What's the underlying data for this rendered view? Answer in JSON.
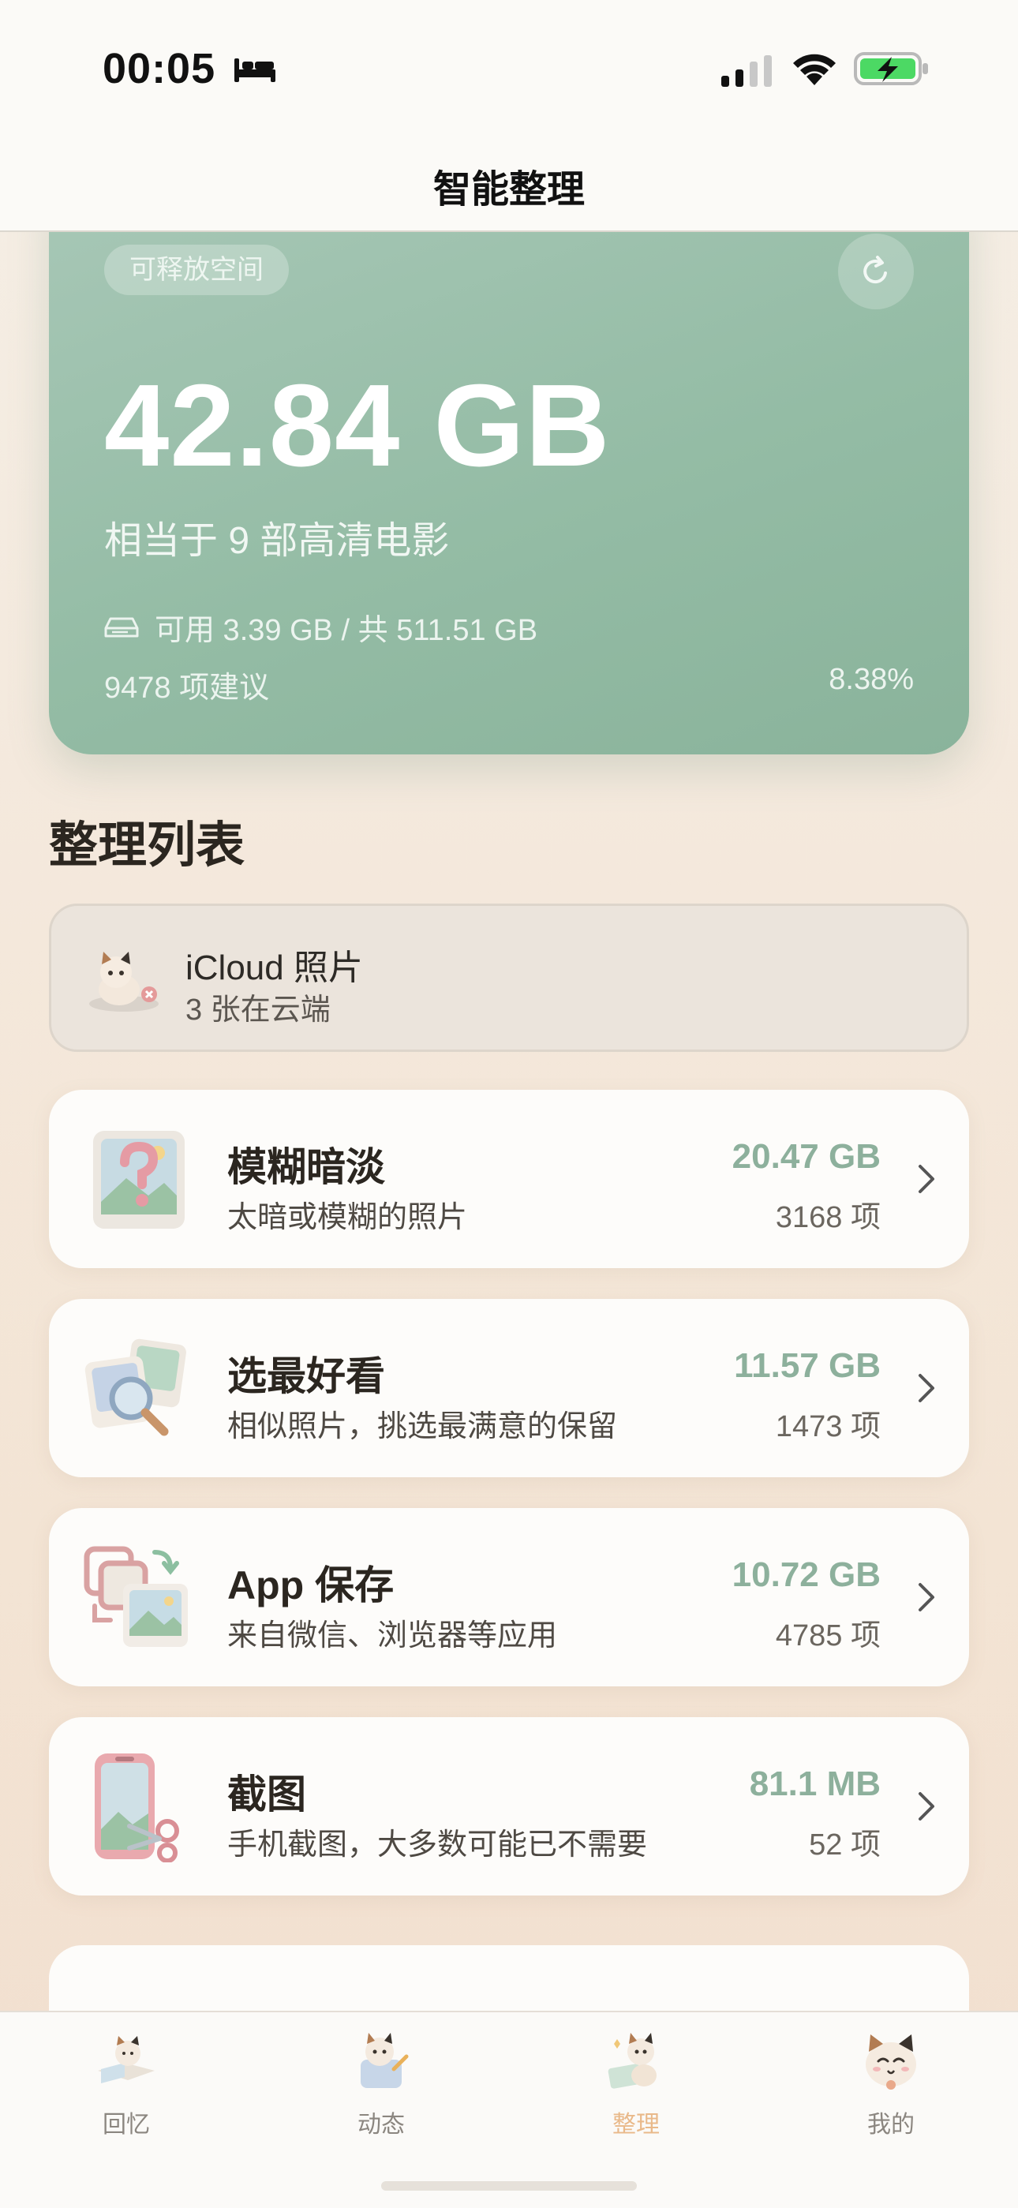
{
  "status_bar": {
    "time": "00:05"
  },
  "nav": {
    "title": "智能整理"
  },
  "hero": {
    "pill": "可释放空间",
    "size": "42.84 GB",
    "equivalent": "相当于 9 部高清电影",
    "available": "可用 3.39 GB / 共 511.51 GB",
    "suggestions": "9478 项建议",
    "percent": "8.38%"
  },
  "section": {
    "title": "整理列表"
  },
  "icloud": {
    "title": "iCloud 照片",
    "subtitle": "3 张在云端"
  },
  "cards": [
    {
      "title": "模糊暗淡",
      "subtitle": "太暗或模糊的照片",
      "size": "20.47 GB",
      "count": "3168 项",
      "icon": "blurry-photo-icon"
    },
    {
      "title": "选最好看",
      "subtitle": "相似照片，挑选最满意的保留",
      "size": "11.57 GB",
      "count": "1473 项",
      "icon": "similar-photos-icon"
    },
    {
      "title": "App 保存",
      "subtitle": "来自微信、浏览器等应用",
      "size": "10.72 GB",
      "count": "4785 项",
      "icon": "app-saved-icon"
    },
    {
      "title": "截图",
      "subtitle": "手机截图，大多数可能已不需要",
      "size": "81.1 MB",
      "count": "52 项",
      "icon": "screenshot-icon"
    }
  ],
  "tabs": [
    {
      "label": "回忆",
      "icon": "memories-icon",
      "active": false
    },
    {
      "label": "动态",
      "icon": "feed-icon",
      "active": false
    },
    {
      "label": "整理",
      "icon": "organize-icon",
      "active": true
    },
    {
      "label": "我的",
      "icon": "profile-icon",
      "active": false
    }
  ],
  "colors": {
    "accent_green": "#8db09c",
    "hero_green": "#94bca5",
    "active_tab": "#e9b98a"
  }
}
